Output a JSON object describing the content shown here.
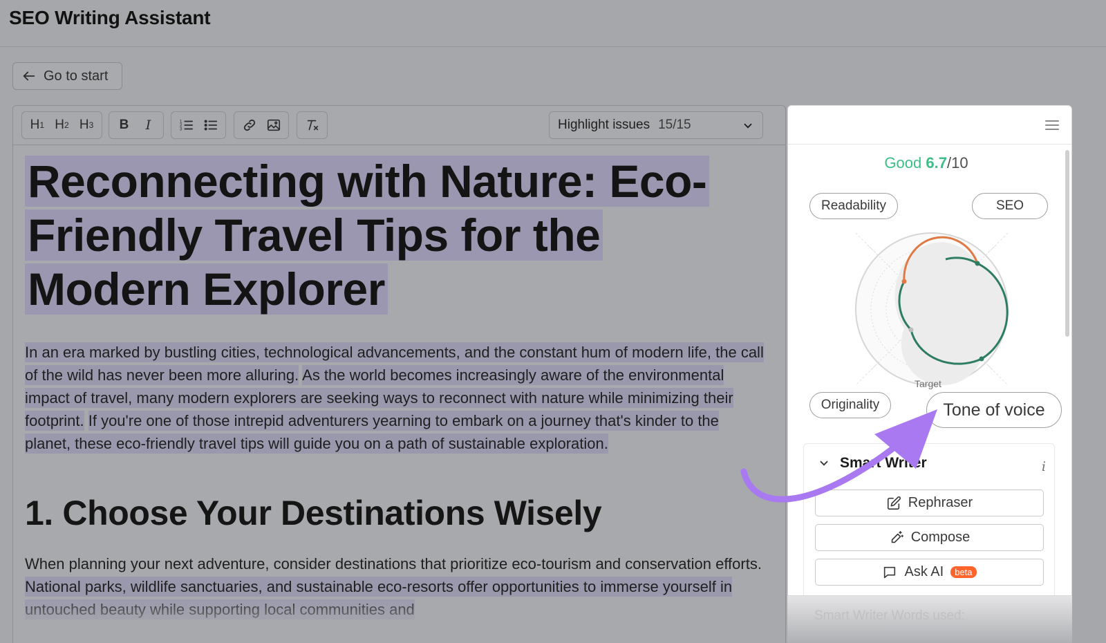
{
  "app": {
    "title": "SEO Writing Assistant"
  },
  "nav": {
    "back_label": "Go to start"
  },
  "toolbar": {
    "headings": [
      {
        "main": "H",
        "sub": "1"
      },
      {
        "main": "H",
        "sub": "2"
      },
      {
        "main": "H",
        "sub": "3"
      }
    ],
    "bold": "B",
    "italic": "I",
    "highlight_select": {
      "label": "Highlight issues",
      "count": "15/15"
    }
  },
  "document": {
    "title": "Reconnecting with Nature: Eco-Friendly Travel Tips for the Modern Explorer",
    "paragraph1": [
      {
        "text": "In an era marked by bustling cities, technological advancements, and the constant hum of modern life, the call of the wild has never been more alluring.",
        "highlight": true
      },
      {
        "text": " ",
        "highlight": false
      },
      {
        "text": "As the world becomes increasingly aware of the environmental impact of travel, many modern explorers are seeking ways to reconnect with nature while minimizing their footprint.",
        "highlight": true
      },
      {
        "text": " ",
        "highlight": false
      },
      {
        "text": "If you're one of those intrepid adventurers yearning to embark on a journey that's kinder to the planet, these eco-friendly travel tips will guide you on a path of sustainable exploration.",
        "highlight": true
      }
    ],
    "heading2": "1. Choose Your Destinations Wisely",
    "paragraph2": [
      {
        "text": "When planning your next adventure, consider destinations that prioritize eco-tourism and conservation efforts. ",
        "highlight": false
      },
      {
        "text": "National parks, wildlife sanctuaries, and sustainable eco-resorts offer opportunities to immerse yourself in untouched beauty while supporting local communities and",
        "highlight": true
      }
    ]
  },
  "panel": {
    "score": {
      "label": "Good",
      "value": "6.7",
      "max": "/10"
    },
    "axes": {
      "readability": "Readability",
      "seo": "SEO",
      "originality": "Originality",
      "tone": "Tone of voice"
    },
    "target_label": "Target",
    "smart_writer": {
      "title": "Smart Writer",
      "info": "i",
      "buttons": {
        "rephraser": "Rephraser",
        "compose": "Compose",
        "ask_ai": "Ask AI",
        "ask_ai_badge": "beta"
      },
      "words_used": "Smart Writer Words used:"
    }
  },
  "colors": {
    "score_good": "#3cbf87",
    "arc_orange": "#e07a45",
    "arc_green": "#2e7d63",
    "arrow_purple": "#a879f0",
    "beta_badge": "#ff642d",
    "issue_highlight": "#9b97b0"
  }
}
